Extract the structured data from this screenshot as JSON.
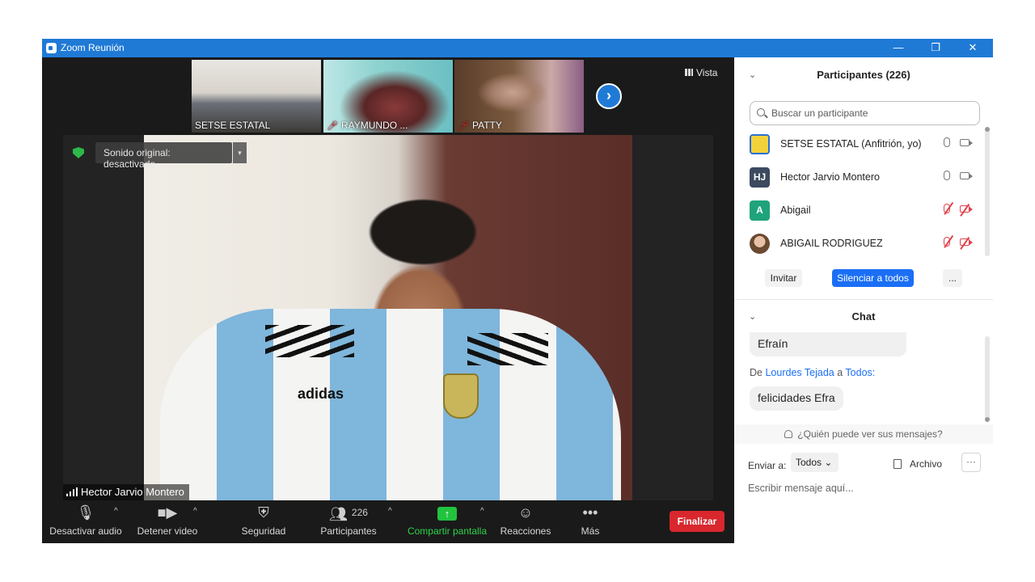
{
  "window": {
    "title": "Zoom Reunión",
    "minimize": "—",
    "restore": "❐",
    "close": "✕"
  },
  "thumbnails": [
    {
      "name": "SETSE ESTATAL",
      "muted": false
    },
    {
      "name": "RAYMUNDO ...",
      "muted": true
    },
    {
      "name": "PATTY",
      "muted": true
    }
  ],
  "thumb_next": "›",
  "view_label": "Vista",
  "main_video": {
    "sound_badge": "Sonido original: desactivado",
    "caret": "▾",
    "speaker_name": "Hector Jarvio Montero",
    "jersey_brand": "adidas"
  },
  "toolbar": {
    "caret": "^",
    "audio": "Desactivar audio",
    "video": "Detener video",
    "security": "Seguridad",
    "participants": "Participantes",
    "participants_count": "226",
    "share": "Compartir pantalla",
    "share_icon": "↑",
    "reactions": "Reacciones",
    "more": "Más",
    "more_icon": "•••",
    "end": "Finalizar"
  },
  "participants_panel": {
    "chevron": "⌄",
    "title": "Participantes (226)",
    "search_placeholder": "Buscar un participante",
    "list": [
      {
        "name": "SETSE ESTATAL (Anfitrión, yo)",
        "initials": "",
        "avatar_color": "#f2d23a",
        "mic_on": true,
        "cam_on": true
      },
      {
        "name": "Hector Jarvio Montero",
        "initials": "HJ",
        "avatar_color": "#3b4a5e",
        "mic_on": true,
        "cam_on": true
      },
      {
        "name": "Abigail",
        "initials": "A",
        "avatar_color": "#1fa37a",
        "mic_on": false,
        "cam_on": false
      },
      {
        "name": "ABIGAIL RODRIGUEZ",
        "initials": "",
        "avatar_color": "#d8a98a",
        "mic_on": false,
        "cam_on": false
      }
    ],
    "invite": "Invitar",
    "mute_all": "Silenciar a todos",
    "more": "..."
  },
  "chat": {
    "title": "Chat",
    "prev_message": "Efraín",
    "from_prefix": "De",
    "from_name": "Lourdes Tejada",
    "connector": "a",
    "to_name": "Todos:",
    "message": "felicidades Efra",
    "who_sees": "¿Quién puede ver sus mensajes?",
    "send_to_label": "Enviar a:",
    "send_to_value": "Todos ⌄",
    "file": "Archivo",
    "more": "···",
    "input_placeholder": "Escribir mensaje aquí..."
  },
  "colors": {
    "titlebar": "#1f7ad6",
    "end_button": "#d9272e",
    "share": "#22c33e",
    "primary_button": "#1b6ff5"
  }
}
